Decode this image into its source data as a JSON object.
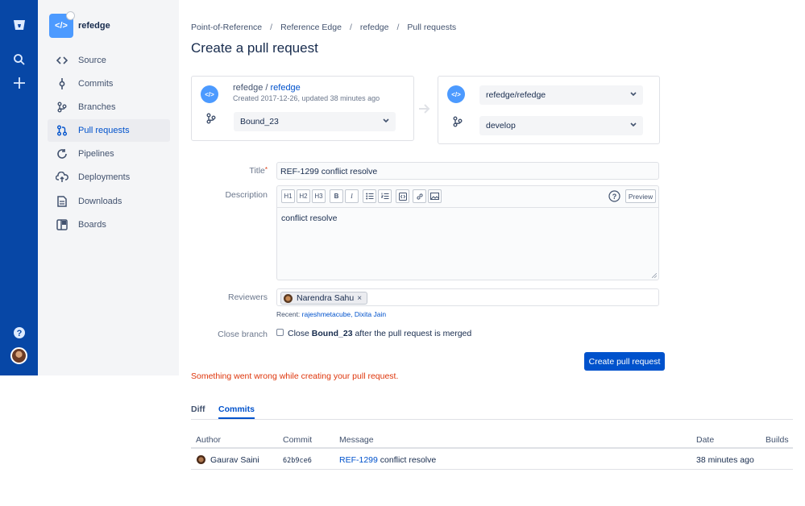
{
  "project": {
    "name": "refedge",
    "logo_text": "</>"
  },
  "sidebar": {
    "items": [
      {
        "label": "Source",
        "icon": "code-icon"
      },
      {
        "label": "Commits",
        "icon": "commit-icon"
      },
      {
        "label": "Branches",
        "icon": "branch-icon"
      },
      {
        "label": "Pull requests",
        "icon": "pull-request-icon"
      },
      {
        "label": "Pipelines",
        "icon": "pipelines-icon"
      },
      {
        "label": "Deployments",
        "icon": "cloud-upload-icon"
      },
      {
        "label": "Downloads",
        "icon": "document-icon"
      },
      {
        "label": "Boards",
        "icon": "board-icon"
      }
    ]
  },
  "breadcrumb": [
    "Point-of-Reference",
    "Reference Edge",
    "refedge",
    "Pull requests"
  ],
  "breadcrumb_sep": "/",
  "page_title": "Create a pull request",
  "source": {
    "owner": "refedge",
    "sep": " / ",
    "repo": "refedge",
    "meta": "Created 2017-12-26, updated 38 minutes ago",
    "branch": "Bound_23"
  },
  "destination": {
    "repo": "refedge/refedge",
    "branch": "develop"
  },
  "form": {
    "title_label": "Title",
    "title_value": "REF-1299 conflict resolve",
    "description_label": "Description",
    "description_value": "conflict resolve",
    "toolbar": {
      "h1": "H1",
      "h2": "H2",
      "h3": "H3",
      "bold": "B",
      "italic": "I",
      "preview": "Preview"
    },
    "reviewers_label": "Reviewers",
    "reviewer_chip": "Narendra Sahu",
    "recent_label": "Recent:",
    "recent_users": "rajeshmetacube, Dixita Jain",
    "close_branch_label": "Close branch",
    "close_branch_prefix": "Close",
    "close_branch_name": "Bound_23",
    "close_branch_suffix": "after the pull request is merged",
    "submit": "Create pull request",
    "error": "Something went wrong while creating your pull request."
  },
  "tabs": [
    "Diff",
    "Commits"
  ],
  "active_tab": "Commits",
  "commits_table": {
    "headers": [
      "Author",
      "Commit",
      "Message",
      "Date",
      "Builds"
    ],
    "rows": [
      {
        "author": "Gaurav Saini",
        "commit": "62b9ce6",
        "issue": "REF-1299",
        "message": "conflict resolve",
        "date": "38 minutes ago"
      }
    ]
  },
  "colors": {
    "global_nav": "#0747a6",
    "primary": "#0052cc",
    "error": "#de350b",
    "sidebar_bg": "#f4f5f7"
  }
}
